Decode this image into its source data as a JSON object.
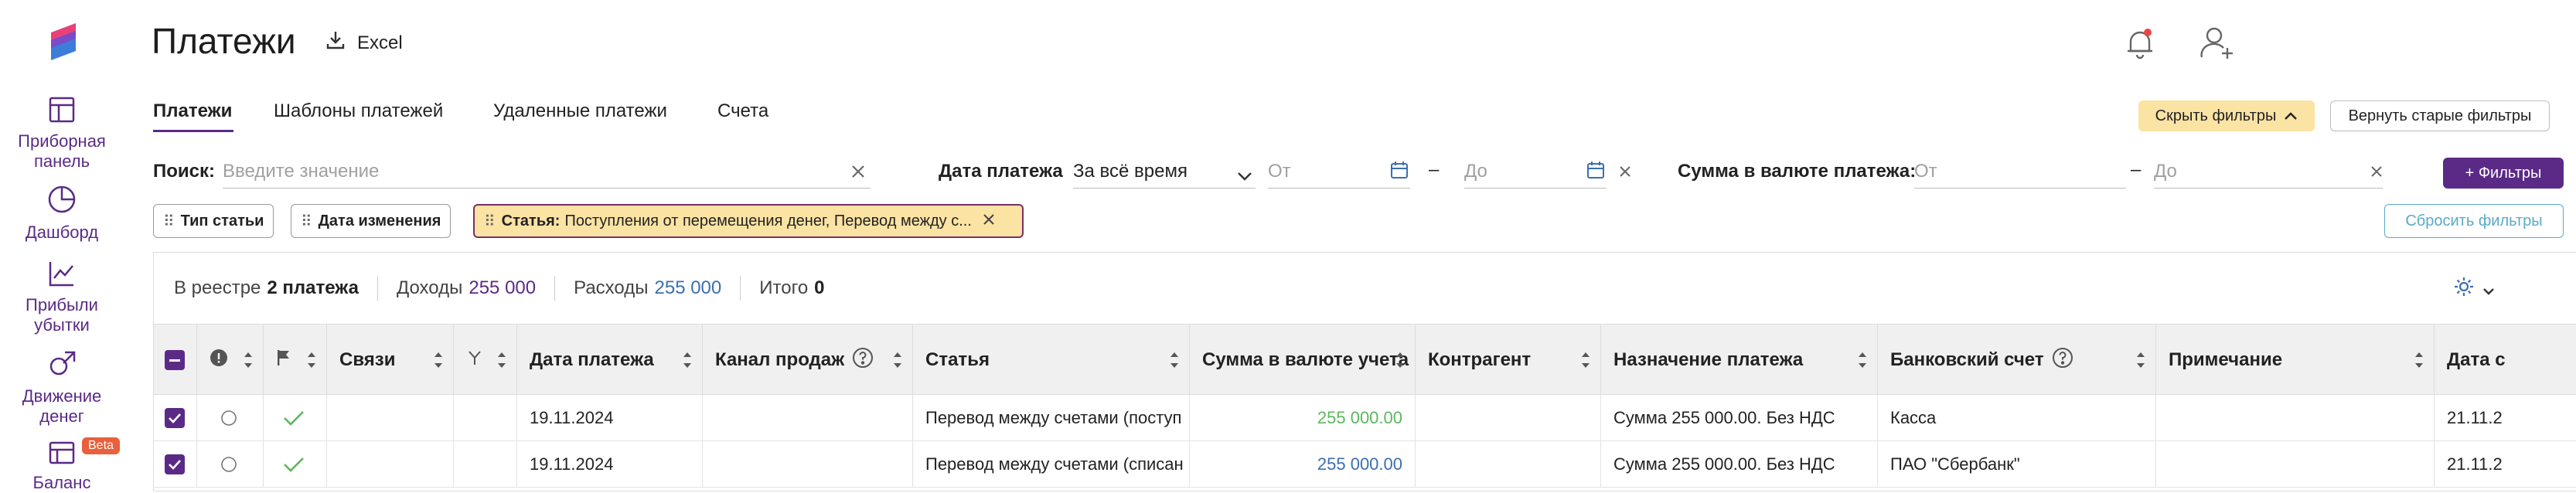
{
  "page": {
    "title": "Платежи",
    "excel_label": "Excel"
  },
  "sidebar": {
    "items": [
      {
        "label_line1": "Приборная",
        "label_line2": "панель"
      },
      {
        "label_line1": "Дашборд",
        "label_line2": ""
      },
      {
        "label_line1": "Прибыли",
        "label_line2": "убытки"
      },
      {
        "label_line1": "Движение",
        "label_line2": "денег"
      },
      {
        "label_line1": "Баланс",
        "label_line2": ""
      }
    ],
    "beta_badge": "Beta"
  },
  "tabs": [
    "Платежи",
    "Шаблоны платежей",
    "Удаленные платежи",
    "Счета"
  ],
  "filters": {
    "hide_filters_label": "Скрыть фильтры",
    "old_filters_label": "Вернуть старые фильтры",
    "search_label": "Поиск:",
    "search_placeholder": "Введите значение",
    "date_label": "Дата платежа",
    "date_value": "За всё время",
    "from_placeholder": "От",
    "to_placeholder": "До",
    "dash": "–",
    "amount_label": "Сумма в валюте платежа:",
    "add_filters_label": "+ Фильтры",
    "reset_filters_label": "Сбросить фильтры",
    "chips": {
      "article_type": "Тип статьи",
      "change_date": "Дата изменения",
      "article_key": "Статья:",
      "article_value": "Поступления от перемещения денег, Перевод между с..."
    }
  },
  "summary": {
    "registry_prefix": "В реестре",
    "registry_count": "2 платежа",
    "income_label": "Доходы",
    "income_value": "255 000",
    "expense_label": "Расходы",
    "expense_value": "255 000",
    "total_label": "Итого",
    "total_value": "0"
  },
  "table": {
    "headers": {
      "links": "Связи",
      "date": "Дата платежа",
      "channel": "Канал продаж",
      "article": "Статья",
      "amount": "Сумма в валюте учета",
      "counterparty": "Контрагент",
      "purpose": "Назначение платежа",
      "bank": "Банковский счет",
      "note": "Примечание",
      "date2": "Дата с"
    },
    "rows": [
      {
        "date": "19.11.2024",
        "article": "Перевод между счетами (поступ",
        "amount": "255 000.00",
        "amount_color": "#5cb85c",
        "purpose": "Сумма 255 000.00. Без НДС",
        "bank": "Касса",
        "date2": "21.11.2"
      },
      {
        "date": "19.11.2024",
        "article": "Перевод между счетами (списан",
        "amount": "255 000.00",
        "amount_color": "#3a6fb0",
        "purpose": "Сумма 255 000.00. Без НДС",
        "bank": "ПАО \"Сбербанк\"",
        "date2": "21.11.2"
      }
    ]
  },
  "colors": {
    "brand": "#5b2a86",
    "highlight": "#fbe3a4",
    "income": "#5b2a86",
    "expense": "#3a6fb0"
  }
}
